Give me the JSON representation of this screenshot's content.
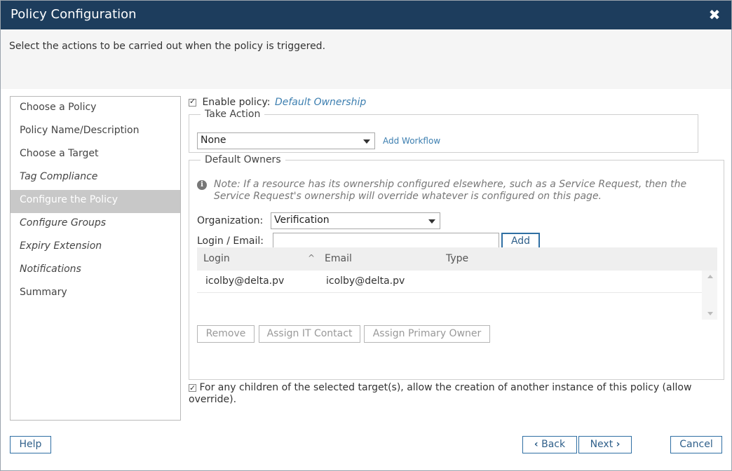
{
  "window": {
    "title": "Policy Configuration",
    "close_icon": "close-icon"
  },
  "instructions": "Select the actions to be carried out when the policy is triggered.",
  "steps": [
    {
      "label": "Choose a Policy",
      "italic": false
    },
    {
      "label": "Policy Name/Description",
      "italic": false
    },
    {
      "label": "Choose a Target",
      "italic": false
    },
    {
      "label": "Tag Compliance",
      "italic": true
    },
    {
      "label": "Configure the Policy",
      "italic": false,
      "active": true
    },
    {
      "label": "Configure Groups",
      "italic": true
    },
    {
      "label": "Expiry Extension",
      "italic": true
    },
    {
      "label": "Notifications",
      "italic": true
    },
    {
      "label": "Summary",
      "italic": false
    }
  ],
  "enable": {
    "checked": true,
    "label": "Enable policy:",
    "policy_name": "Default Ownership"
  },
  "take_action": {
    "legend": "Take Action",
    "selected": "None",
    "add_workflow": "Add Workflow"
  },
  "owners": {
    "legend": "Default Owners",
    "note": "Note: If a resource has its ownership configured elsewhere, such as a Service Request, then the Service Request's ownership will override whatever is configured on this page.",
    "organization_label": "Organization:",
    "organization_value": "Verification",
    "login_label": "Login / Email:",
    "login_value": "",
    "add_label": "Add",
    "columns": [
      "Login",
      "Email",
      "Type"
    ],
    "rows": [
      {
        "login": "icolby@delta.pv",
        "email": "icolby@delta.pv",
        "type": ""
      }
    ],
    "remove_label": "Remove",
    "assign_it_label": "Assign IT Contact",
    "assign_primary_label": "Assign Primary Owner"
  },
  "override": {
    "checked": true,
    "label": "For any children of the selected target(s), allow the creation of another instance of this policy (allow override)."
  },
  "footer": {
    "help": "Help",
    "back": "Back",
    "next": "Next",
    "cancel": "Cancel"
  },
  "colors": {
    "titlebar": "#1d3d5d",
    "accent": "#3d7fb0",
    "active_step": "#c8c8c8"
  }
}
